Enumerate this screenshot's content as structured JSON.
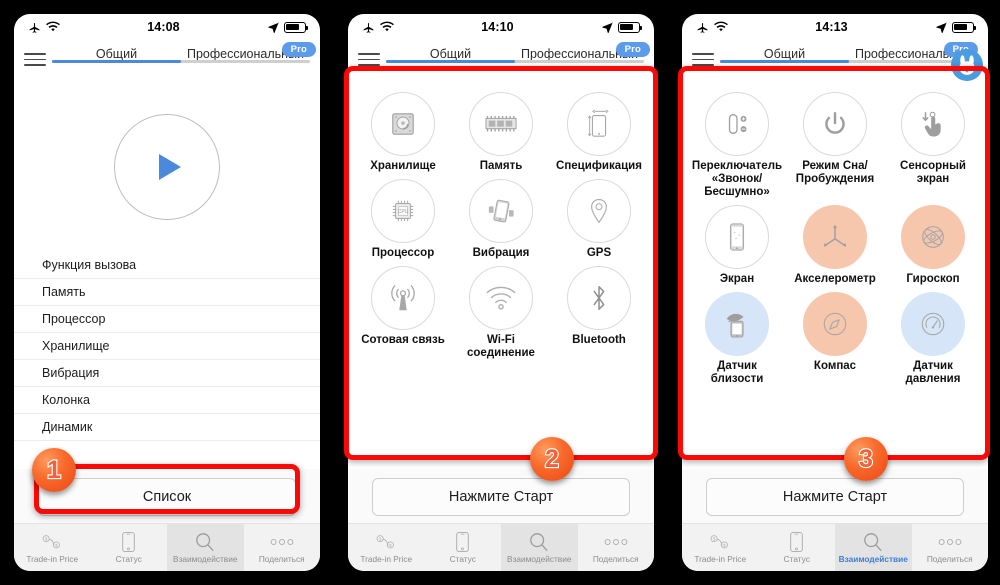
{
  "panels": [
    {
      "status": {
        "time": "14:08",
        "airplane": "airplane-icon",
        "wifi": "wifi-icon",
        "location": "location-arrow-icon",
        "battery": "battery-icon"
      },
      "nav": {
        "menu": "hamburger-icon",
        "tab_general": "Общий",
        "tab_pro": "Профессиональный",
        "pro_badge": "Pro"
      },
      "play": {
        "icon": "play-icon"
      },
      "list": [
        "Функция вызова",
        "Память",
        "Процессор",
        "Хранилище",
        "Вибрация",
        "Колонка",
        "Динамик"
      ],
      "action_button": "Список",
      "tabbar": [
        {
          "label": "Trade-in Price",
          "icon": "trade-in-price-icon",
          "state": "inactive"
        },
        {
          "label": "Статус",
          "icon": "phone-status-icon",
          "state": "inactive"
        },
        {
          "label": "Взаимодействие",
          "icon": "magnifier-icon",
          "state": "selected"
        },
        {
          "label": "Поделиться",
          "icon": "more-dots-icon",
          "state": "inactive"
        }
      ],
      "callout": "1"
    },
    {
      "status": {
        "time": "14:10"
      },
      "nav": {
        "tab_general": "Общий",
        "tab_pro": "Профессиональный",
        "pro_badge": "Pro"
      },
      "grid": [
        {
          "label": "Хранилище",
          "icon": "hard-drive-icon",
          "fill": "none"
        },
        {
          "label": "Память",
          "icon": "ram-module-icon",
          "fill": "none"
        },
        {
          "label": "Спецификация",
          "icon": "device-dimensions-icon",
          "fill": "none"
        },
        {
          "label": "Процессор",
          "icon": "cpu-chip-icon",
          "fill": "none"
        },
        {
          "label": "Вибрация",
          "icon": "vibration-phone-icon",
          "fill": "none"
        },
        {
          "label": "GPS",
          "icon": "map-pin-icon",
          "fill": "none"
        },
        {
          "label": "Сотовая связь",
          "icon": "cellular-antenna-icon",
          "fill": "none"
        },
        {
          "label": "Wi-Fi соединение",
          "icon": "wifi-icon",
          "fill": "none"
        },
        {
          "label": "Bluetooth",
          "icon": "bluetooth-icon",
          "fill": "none"
        }
      ],
      "action_button": "Нажмите Старт",
      "tabbar": [
        {
          "label": "Trade-in Price",
          "icon": "trade-in-price-icon",
          "state": "inactive"
        },
        {
          "label": "Статус",
          "icon": "phone-status-icon",
          "state": "inactive"
        },
        {
          "label": "Взаимодействие",
          "icon": "magnifier-icon",
          "state": "selected"
        },
        {
          "label": "Поделиться",
          "icon": "more-dots-icon",
          "state": "inactive"
        }
      ],
      "callout": "2"
    },
    {
      "status": {
        "time": "14:13"
      },
      "nav": {
        "tab_general": "Общий",
        "tab_pro": "Профессиональный",
        "pro_badge": "Pro",
        "mascot": "rabbit-mascot-icon"
      },
      "grid": [
        {
          "label": "Переключатель «Звонок/Бесшумно»",
          "icon": "ringer-switch-icon",
          "fill": "none"
        },
        {
          "label": "Режим Сна/Пробуждения",
          "icon": "power-icon",
          "fill": "none"
        },
        {
          "label": "Сенсорный экран",
          "icon": "touch-hand-icon",
          "fill": "none"
        },
        {
          "label": "Экран",
          "icon": "screen-icon",
          "fill": "none"
        },
        {
          "label": "Акселерометр",
          "icon": "accelerometer-axes-icon",
          "fill": "peach"
        },
        {
          "label": "Гироскоп",
          "icon": "gyroscope-icon",
          "fill": "peach"
        },
        {
          "label": "Датчик близости",
          "icon": "proximity-sensor-icon",
          "fill": "blue"
        },
        {
          "label": "Компас",
          "icon": "compass-icon",
          "fill": "peach"
        },
        {
          "label": "Датчик давления",
          "icon": "pressure-gauge-icon",
          "fill": "blue"
        }
      ],
      "action_button": "Нажмите Старт",
      "tabbar": [
        {
          "label": "Trade-in Price",
          "icon": "trade-in-price-icon",
          "state": "inactive"
        },
        {
          "label": "Статус",
          "icon": "phone-status-icon",
          "state": "inactive"
        },
        {
          "label": "Взаимодействие",
          "icon": "magnifier-icon",
          "state": "active"
        },
        {
          "label": "Поделиться",
          "icon": "more-dots-icon",
          "state": "inactive"
        }
      ],
      "callout": "3"
    }
  ],
  "colors": {
    "accent_blue": "#4a89dc",
    "highlight_red": "#fb0a05",
    "badge_orange": "#f4603a",
    "peach_fill": "#f6c7ac",
    "blue_fill": "#d6e6f8",
    "pro_badge": "#5b9bea"
  }
}
